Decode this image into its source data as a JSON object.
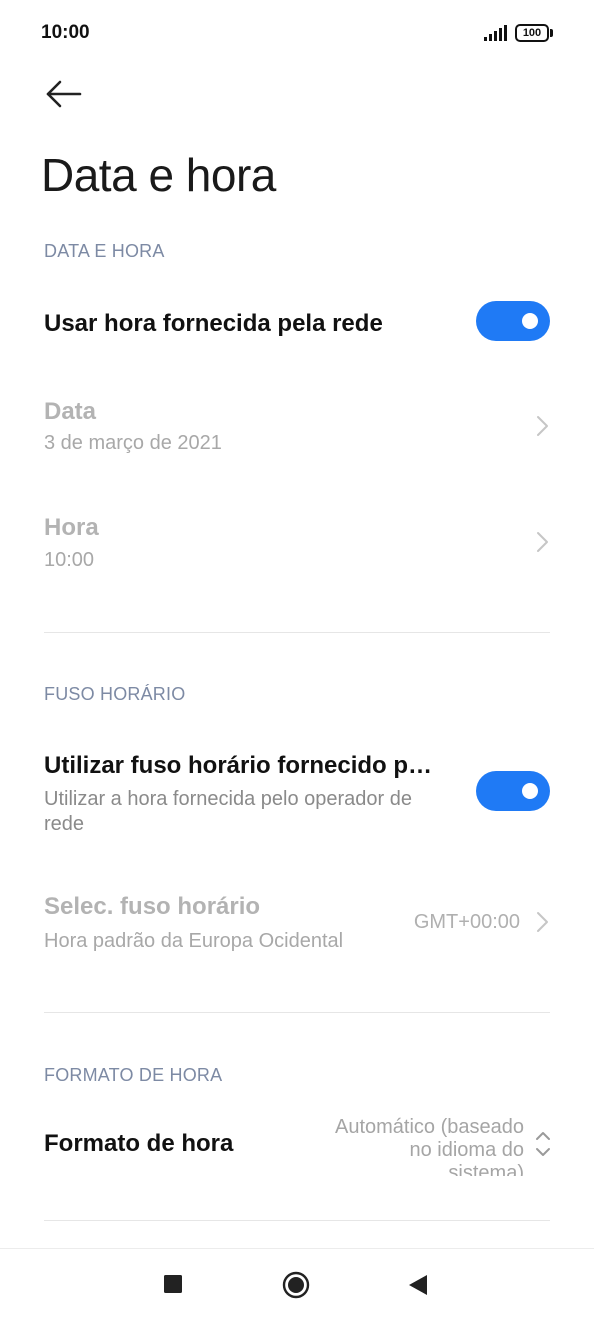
{
  "status_bar": {
    "time": "10:00",
    "battery": "100",
    "icons": [
      "signal-icon",
      "battery-icon"
    ]
  },
  "header": {
    "back_icon": "arrow-left-icon",
    "title": "Data e hora"
  },
  "sections": {
    "date_time": {
      "header": "DATA E HORA",
      "network_time": {
        "title": "Usar hora fornecida pela rede",
        "enabled": true
      },
      "date": {
        "title": "Data",
        "value": "3 de março de 2021"
      },
      "time": {
        "title": "Hora",
        "value": "10:00"
      }
    },
    "timezone": {
      "header": "FUSO HORÁRIO",
      "network_tz": {
        "title": "Utilizar fuso horário fornecido p…",
        "subtitle_line1": "Utilizar a hora fornecida pelo operador de",
        "subtitle_line2": "rede",
        "enabled": true
      },
      "select_tz": {
        "title": "Selec. fuso horário",
        "subtitle": "Hora padrão da Europa Ocidental",
        "value": "GMT+00:00"
      }
    },
    "time_format": {
      "header": "FORMATO DE HORA",
      "format": {
        "title": "Formato de hora",
        "value_line1": "Automático (baseado",
        "value_line2": "no idioma do",
        "value_line3": "sistema)"
      }
    }
  },
  "colors": {
    "accent": "#1f7af5",
    "section_header": "#7d8aa4",
    "disabled_text": "#b3b3b3"
  },
  "nav_bar": {
    "icons": [
      "square-recents-icon",
      "circle-home-icon",
      "triangle-back-icon"
    ]
  }
}
